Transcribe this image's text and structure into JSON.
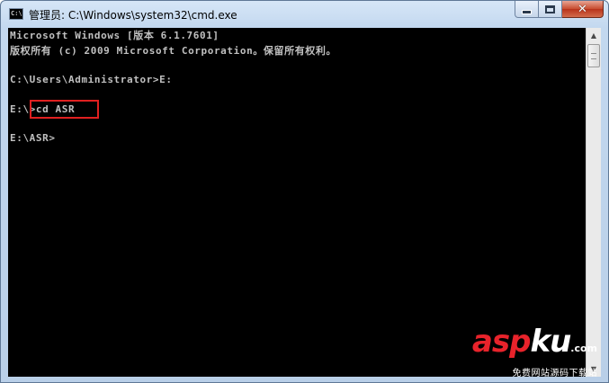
{
  "window": {
    "title": "管理员: C:\\Windows\\system32\\cmd.exe",
    "icon": "cmd-console-icon",
    "icon_text": "C:\\",
    "buttons": {
      "minimize": "minimize-icon",
      "maximize": "maximize-icon",
      "close": "✕"
    }
  },
  "console": {
    "lines": [
      "Microsoft Windows [版本 6.1.7601]",
      "版权所有 (c) 2009 Microsoft Corporation。保留所有权利。",
      "",
      "C:\\Users\\Administrator>E:",
      "",
      "E:\\>cd ASR",
      "",
      "E:\\ASR>"
    ],
    "highlight_color": "#e02020",
    "text_color": "#c0c0c0",
    "background": "#000000"
  },
  "scrollbar": {
    "up": "▲",
    "down": "▼"
  },
  "watermark": {
    "logo_red": "asp",
    "logo_white": "ku",
    "suffix": ".com",
    "subtitle": "免费网站源码下载站"
  }
}
